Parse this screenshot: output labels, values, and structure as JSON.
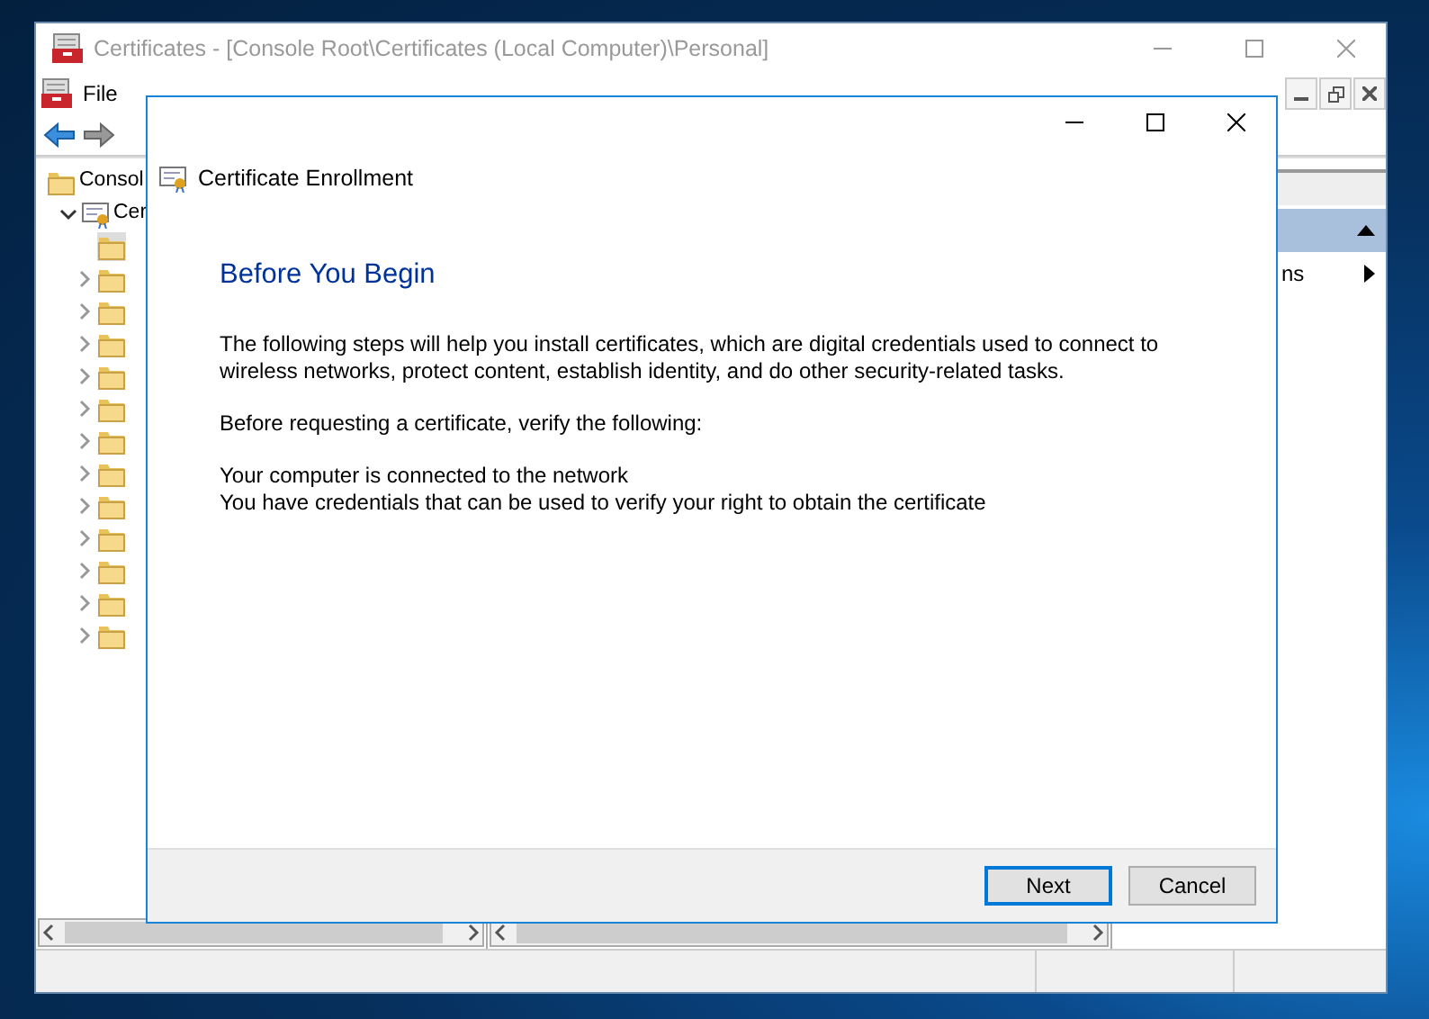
{
  "main_window": {
    "title": "Certificates - [Console Root\\Certificates (Local Computer)\\Personal]",
    "active": false,
    "menu": [
      "File"
    ],
    "tree": [
      {
        "label": "Consol",
        "expandable": false,
        "selected": false,
        "children": [
          {
            "label": "Cer",
            "expandable": true,
            "expanded": true,
            "selected": false,
            "children": [
              {
                "expandable": false,
                "selected": true
              },
              {
                "expandable": true,
                "expanded": false,
                "selected": false
              },
              {
                "expandable": true,
                "expanded": false,
                "selected": false
              },
              {
                "expandable": true,
                "expanded": false,
                "selected": false
              },
              {
                "expandable": true,
                "expanded": false,
                "selected": false
              },
              {
                "expandable": true,
                "expanded": false,
                "selected": false
              },
              {
                "expandable": true,
                "expanded": false,
                "selected": false
              },
              {
                "expandable": true,
                "expanded": false,
                "selected": false
              },
              {
                "expandable": true,
                "expanded": false,
                "selected": false
              },
              {
                "expandable": true,
                "expanded": false,
                "selected": false
              },
              {
                "expandable": true,
                "expanded": false,
                "selected": false
              },
              {
                "expandable": true,
                "expanded": false,
                "selected": false
              },
              {
                "expandable": true,
                "expanded": false,
                "selected": false
              }
            ]
          }
        ]
      }
    ],
    "actions": [
      {
        "kind": "group-header"
      },
      {
        "kind": "item",
        "label": "ns"
      }
    ]
  },
  "dialog": {
    "title": "Certificate Enrollment",
    "heading": "Before You Begin",
    "paragraphs": [
      "The following steps will help you install certificates, which are digital credentials used to connect to wireless networks, protect content, establish identity, and do other security-related tasks.",
      "Before requesting a certificate, verify the following:"
    ],
    "checklist": [
      "Your computer is connected to the network",
      "You have credentials that can be used to verify your right to obtain the certificate"
    ],
    "buttons": [
      {
        "label": "Next",
        "default": true
      },
      {
        "label": "Cancel",
        "default": false
      }
    ]
  }
}
